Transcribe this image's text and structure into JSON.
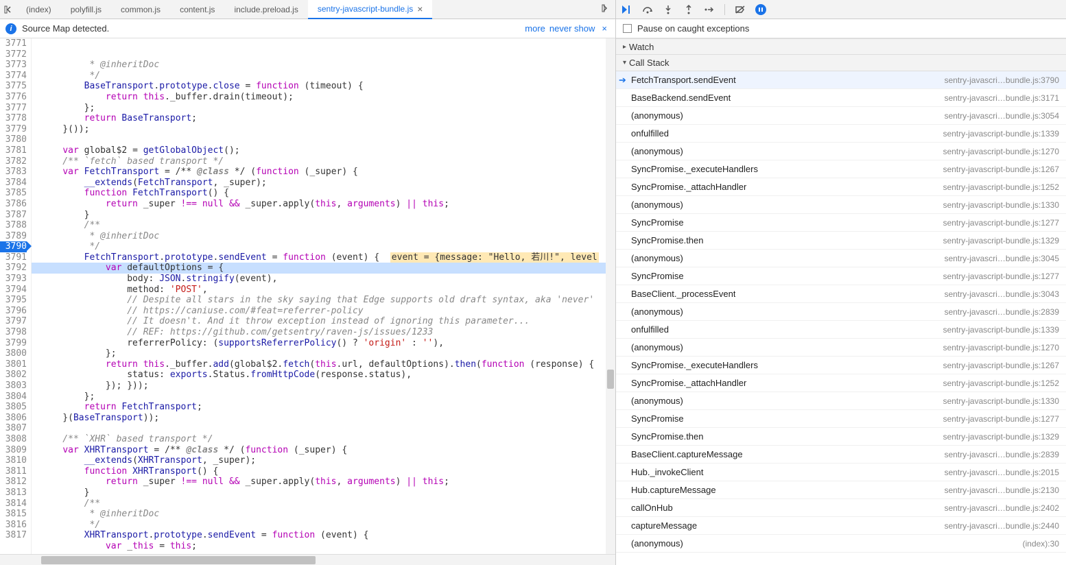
{
  "tabs": [
    "(index)",
    "polyfill.js",
    "common.js",
    "content.js",
    "include.preload.js",
    "sentry-javascript-bundle.js"
  ],
  "active_tab": 5,
  "infobar": {
    "text": "Source Map detected.",
    "more": "more",
    "never": "never show"
  },
  "pause_checkbox_label": "Pause on caught exceptions",
  "watch_label": "Watch",
  "callstack_label": "Call Stack",
  "first_line": 3771,
  "highlight_line": 3790,
  "code_lines": [
    {
      "t": "doccom",
      "c": "         * @inheritDoc"
    },
    {
      "t": "doccom",
      "c": "         */"
    },
    {
      "t": "code",
      "c": "        BaseTransport.prototype.close = function (timeout) {",
      "h": {
        "close": "fn",
        "function": "kw",
        "prototype": "name",
        "BaseTransport": "name"
      }
    },
    {
      "t": "code",
      "c": "            return this._buffer.drain(timeout);",
      "h": {
        "return": "kw",
        "this": "kw"
      }
    },
    {
      "t": "code",
      "c": "        };"
    },
    {
      "t": "code",
      "c": "        return BaseTransport;",
      "h": {
        "return": "kw",
        "BaseTransport": "name"
      }
    },
    {
      "t": "code",
      "c": "    }());"
    },
    {
      "t": "code",
      "c": ""
    },
    {
      "t": "code",
      "c": "    var global$2 = getGlobalObject();",
      "h": {
        "var": "kw",
        "getGlobalObject": "fn"
      }
    },
    {
      "t": "com",
      "c": "    /** `fetch` based transport */"
    },
    {
      "t": "code",
      "c": "    var FetchTransport = /** @class */ (function (_super) {",
      "h": {
        "var": "kw",
        "function": "kw",
        "FetchTransport": "name",
        "@class": "atcom"
      }
    },
    {
      "t": "code",
      "c": "        __extends(FetchTransport, _super);",
      "h": {
        "__extends": "fn",
        "FetchTransport": "name"
      }
    },
    {
      "t": "code",
      "c": "        function FetchTransport() {",
      "h": {
        "function": "kw",
        "FetchTransport": "fn"
      }
    },
    {
      "t": "code",
      "c": "            return _super !== null && _super.apply(this, arguments) || this;",
      "h": {
        "return": "kw",
        "null": "kw",
        "this": "kw",
        "arguments": "kw",
        "!==": "op",
        "&&": "op",
        "||": "op"
      }
    },
    {
      "t": "code",
      "c": "        }"
    },
    {
      "t": "doccom",
      "c": "        /**"
    },
    {
      "t": "doccom",
      "c": "         * @inheritDoc"
    },
    {
      "t": "doccom",
      "c": "         */"
    },
    {
      "t": "code",
      "c": "        FetchTransport.prototype.sendEvent = function (event) {",
      "h": {
        "function": "kw",
        "sendEvent": "fn",
        "prototype": "name",
        "FetchTransport": "name"
      },
      "hint": "event = {message: \"Hello, 若川!\", level"
    },
    {
      "t": "code",
      "c": "            var defaultOptions = {",
      "h": {
        "var": "kw"
      }
    },
    {
      "t": "code",
      "c": "                body: JSON.stringify(event),",
      "h": {
        "JSON": "name",
        "stringify": "fn"
      }
    },
    {
      "t": "code",
      "c": "                method: 'POST',",
      "h": {
        "'POST'": "str"
      }
    },
    {
      "t": "com",
      "c": "                // Despite all stars in the sky saying that Edge supports old draft syntax, aka 'never'"
    },
    {
      "t": "com",
      "c": "                // https://caniuse.com/#feat=referrer-policy"
    },
    {
      "t": "com",
      "c": "                // It doesn't. And it throw exception instead of ignoring this parameter..."
    },
    {
      "t": "com",
      "c": "                // REF: https://github.com/getsentry/raven-js/issues/1233"
    },
    {
      "t": "code",
      "c": "                referrerPolicy: (supportsReferrerPolicy() ? 'origin' : ''),",
      "h": {
        "supportsReferrerPolicy": "fn",
        "'origin'": "str",
        "''": "str"
      }
    },
    {
      "t": "code",
      "c": "            };"
    },
    {
      "t": "code",
      "c": "            return this._buffer.add(global$2.fetch(this.url, defaultOptions).then(function (response) {",
      "h": {
        "return": "kw",
        "this": "kw",
        "function": "kw",
        "add": "fn",
        "fetch": "fn",
        "then": "fn"
      }
    },
    {
      "t": "code",
      "c": "                status: exports.Status.fromHttpCode(response.status),",
      "h": {
        "fromHttpCode": "fn",
        "exports": "name"
      }
    },
    {
      "t": "code",
      "c": "            }); }));"
    },
    {
      "t": "code",
      "c": "        };"
    },
    {
      "t": "code",
      "c": "        return FetchTransport;",
      "h": {
        "return": "kw",
        "FetchTransport": "name"
      }
    },
    {
      "t": "code",
      "c": "    }(BaseTransport));",
      "h": {
        "BaseTransport": "name"
      }
    },
    {
      "t": "code",
      "c": ""
    },
    {
      "t": "com",
      "c": "    /** `XHR` based transport */"
    },
    {
      "t": "code",
      "c": "    var XHRTransport = /** @class */ (function (_super) {",
      "h": {
        "var": "kw",
        "function": "kw",
        "XHRTransport": "name",
        "@class": "atcom"
      }
    },
    {
      "t": "code",
      "c": "        __extends(XHRTransport, _super);",
      "h": {
        "__extends": "fn",
        "XHRTransport": "name"
      }
    },
    {
      "t": "code",
      "c": "        function XHRTransport() {",
      "h": {
        "function": "kw",
        "XHRTransport": "fn"
      }
    },
    {
      "t": "code",
      "c": "            return _super !== null && _super.apply(this, arguments) || this;",
      "h": {
        "return": "kw",
        "null": "kw",
        "this": "kw",
        "arguments": "kw",
        "!==": "op",
        "&&": "op",
        "||": "op"
      }
    },
    {
      "t": "code",
      "c": "        }"
    },
    {
      "t": "doccom",
      "c": "        /**"
    },
    {
      "t": "doccom",
      "c": "         * @inheritDoc"
    },
    {
      "t": "doccom",
      "c": "         */"
    },
    {
      "t": "code",
      "c": "        XHRTransport.prototype.sendEvent = function (event) {",
      "h": {
        "function": "kw",
        "sendEvent": "fn",
        "prototype": "name",
        "XHRTransport": "name"
      }
    },
    {
      "t": "code",
      "c": "            var _this = this;",
      "h": {
        "var": "kw",
        "this": "kw"
      }
    },
    {
      "t": "code",
      "c": ""
    }
  ],
  "frames": [
    {
      "fn": "FetchTransport.sendEvent",
      "loc": "sentry-javascri…bundle.js:3790",
      "sel": true
    },
    {
      "fn": "BaseBackend.sendEvent",
      "loc": "sentry-javascri…bundle.js:3171"
    },
    {
      "fn": "(anonymous)",
      "loc": "sentry-javascri…bundle.js:3054"
    },
    {
      "fn": "onfulfilled",
      "loc": "sentry-javascript-bundle.js:1339"
    },
    {
      "fn": "(anonymous)",
      "loc": "sentry-javascript-bundle.js:1270"
    },
    {
      "fn": "SyncPromise._executeHandlers",
      "loc": "sentry-javascript-bundle.js:1267"
    },
    {
      "fn": "SyncPromise._attachHandler",
      "loc": "sentry-javascript-bundle.js:1252"
    },
    {
      "fn": "(anonymous)",
      "loc": "sentry-javascript-bundle.js:1330"
    },
    {
      "fn": "SyncPromise",
      "loc": "sentry-javascript-bundle.js:1277"
    },
    {
      "fn": "SyncPromise.then",
      "loc": "sentry-javascript-bundle.js:1329"
    },
    {
      "fn": "(anonymous)",
      "loc": "sentry-javascri…bundle.js:3045"
    },
    {
      "fn": "SyncPromise",
      "loc": "sentry-javascript-bundle.js:1277"
    },
    {
      "fn": "BaseClient._processEvent",
      "loc": "sentry-javascri…bundle.js:3043"
    },
    {
      "fn": "(anonymous)",
      "loc": "sentry-javascri…bundle.js:2839"
    },
    {
      "fn": "onfulfilled",
      "loc": "sentry-javascript-bundle.js:1339"
    },
    {
      "fn": "(anonymous)",
      "loc": "sentry-javascript-bundle.js:1270"
    },
    {
      "fn": "SyncPromise._executeHandlers",
      "loc": "sentry-javascript-bundle.js:1267"
    },
    {
      "fn": "SyncPromise._attachHandler",
      "loc": "sentry-javascript-bundle.js:1252"
    },
    {
      "fn": "(anonymous)",
      "loc": "sentry-javascript-bundle.js:1330"
    },
    {
      "fn": "SyncPromise",
      "loc": "sentry-javascript-bundle.js:1277"
    },
    {
      "fn": "SyncPromise.then",
      "loc": "sentry-javascript-bundle.js:1329"
    },
    {
      "fn": "BaseClient.captureMessage",
      "loc": "sentry-javascri…bundle.js:2839"
    },
    {
      "fn": "Hub._invokeClient",
      "loc": "sentry-javascri…bundle.js:2015"
    },
    {
      "fn": "Hub.captureMessage",
      "loc": "sentry-javascri…bundle.js:2130"
    },
    {
      "fn": "callOnHub",
      "loc": "sentry-javascri…bundle.js:2402"
    },
    {
      "fn": "captureMessage",
      "loc": "sentry-javascri…bundle.js:2440"
    },
    {
      "fn": "(anonymous)",
      "loc": "(index):30"
    }
  ]
}
